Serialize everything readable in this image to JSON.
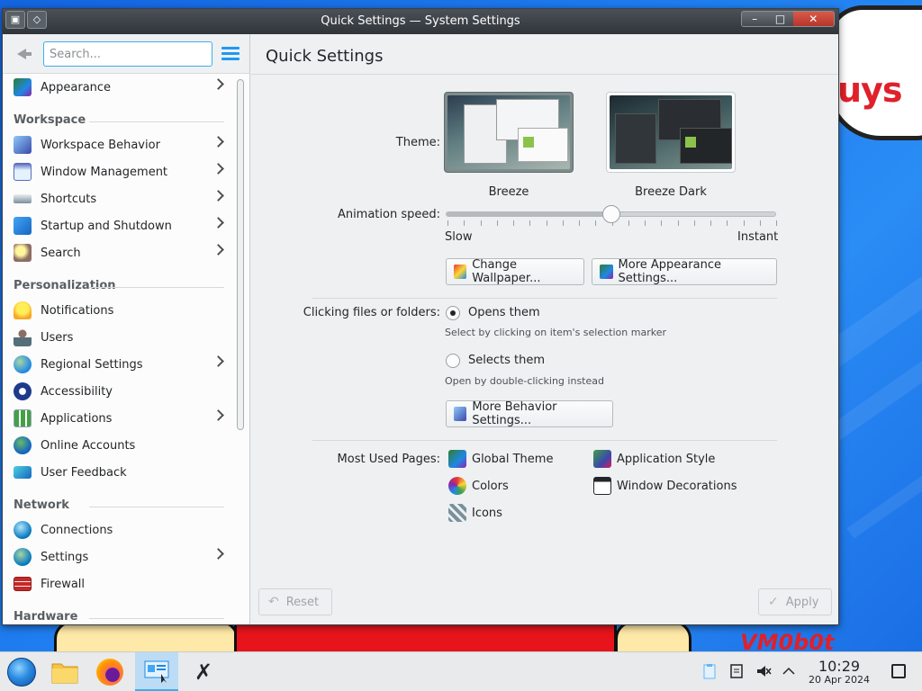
{
  "window": {
    "title": "Quick Settings — System Settings",
    "controls": [
      "–",
      "□",
      "✕"
    ]
  },
  "sidebar": {
    "search_placeholder": "Search...",
    "appearance": "Appearance",
    "categories": {
      "workspace": "Workspace",
      "personalization": "Personalization",
      "network": "Network",
      "hardware": "Hardware"
    },
    "workspace_items": [
      "Workspace Behavior",
      "Window Management",
      "Shortcuts",
      "Startup and Shutdown",
      "Search"
    ],
    "personalization_items": [
      "Notifications",
      "Users",
      "Regional Settings",
      "Accessibility",
      "Applications",
      "Online Accounts",
      "User Feedback"
    ],
    "network_items": [
      "Connections",
      "Settings",
      "Firewall"
    ]
  },
  "main": {
    "title": "Quick Settings",
    "theme_label": "Theme:",
    "themes": [
      "Breeze",
      "Breeze Dark"
    ],
    "animation_label": "Animation speed:",
    "slow": "Slow",
    "instant": "Instant",
    "animation_speed_fraction": 0.5,
    "change_wallpaper": "Change Wallpaper...",
    "more_appearance": "More Appearance Settings...",
    "clicking_label": "Clicking files or folders:",
    "opens_them": "Opens them",
    "opens_hint": "Select by clicking on item's selection marker",
    "selects_them": "Selects them",
    "selects_hint": "Open by double-clicking instead",
    "more_behavior": "More Behavior Settings...",
    "most_used_label": "Most Used Pages:",
    "most_used": [
      "Global Theme",
      "Application Style",
      "Colors",
      "Window Decorations",
      "Icons"
    ],
    "reset": "Reset",
    "apply": "Apply"
  },
  "desktop": {
    "bubble_text": "uys",
    "watermark": "VM0b0t"
  },
  "taskbar": {
    "time": "10:29",
    "date": "20 Apr 2024"
  },
  "colors": {
    "accent": "#3daee9",
    "titlebar": "#30353a"
  }
}
